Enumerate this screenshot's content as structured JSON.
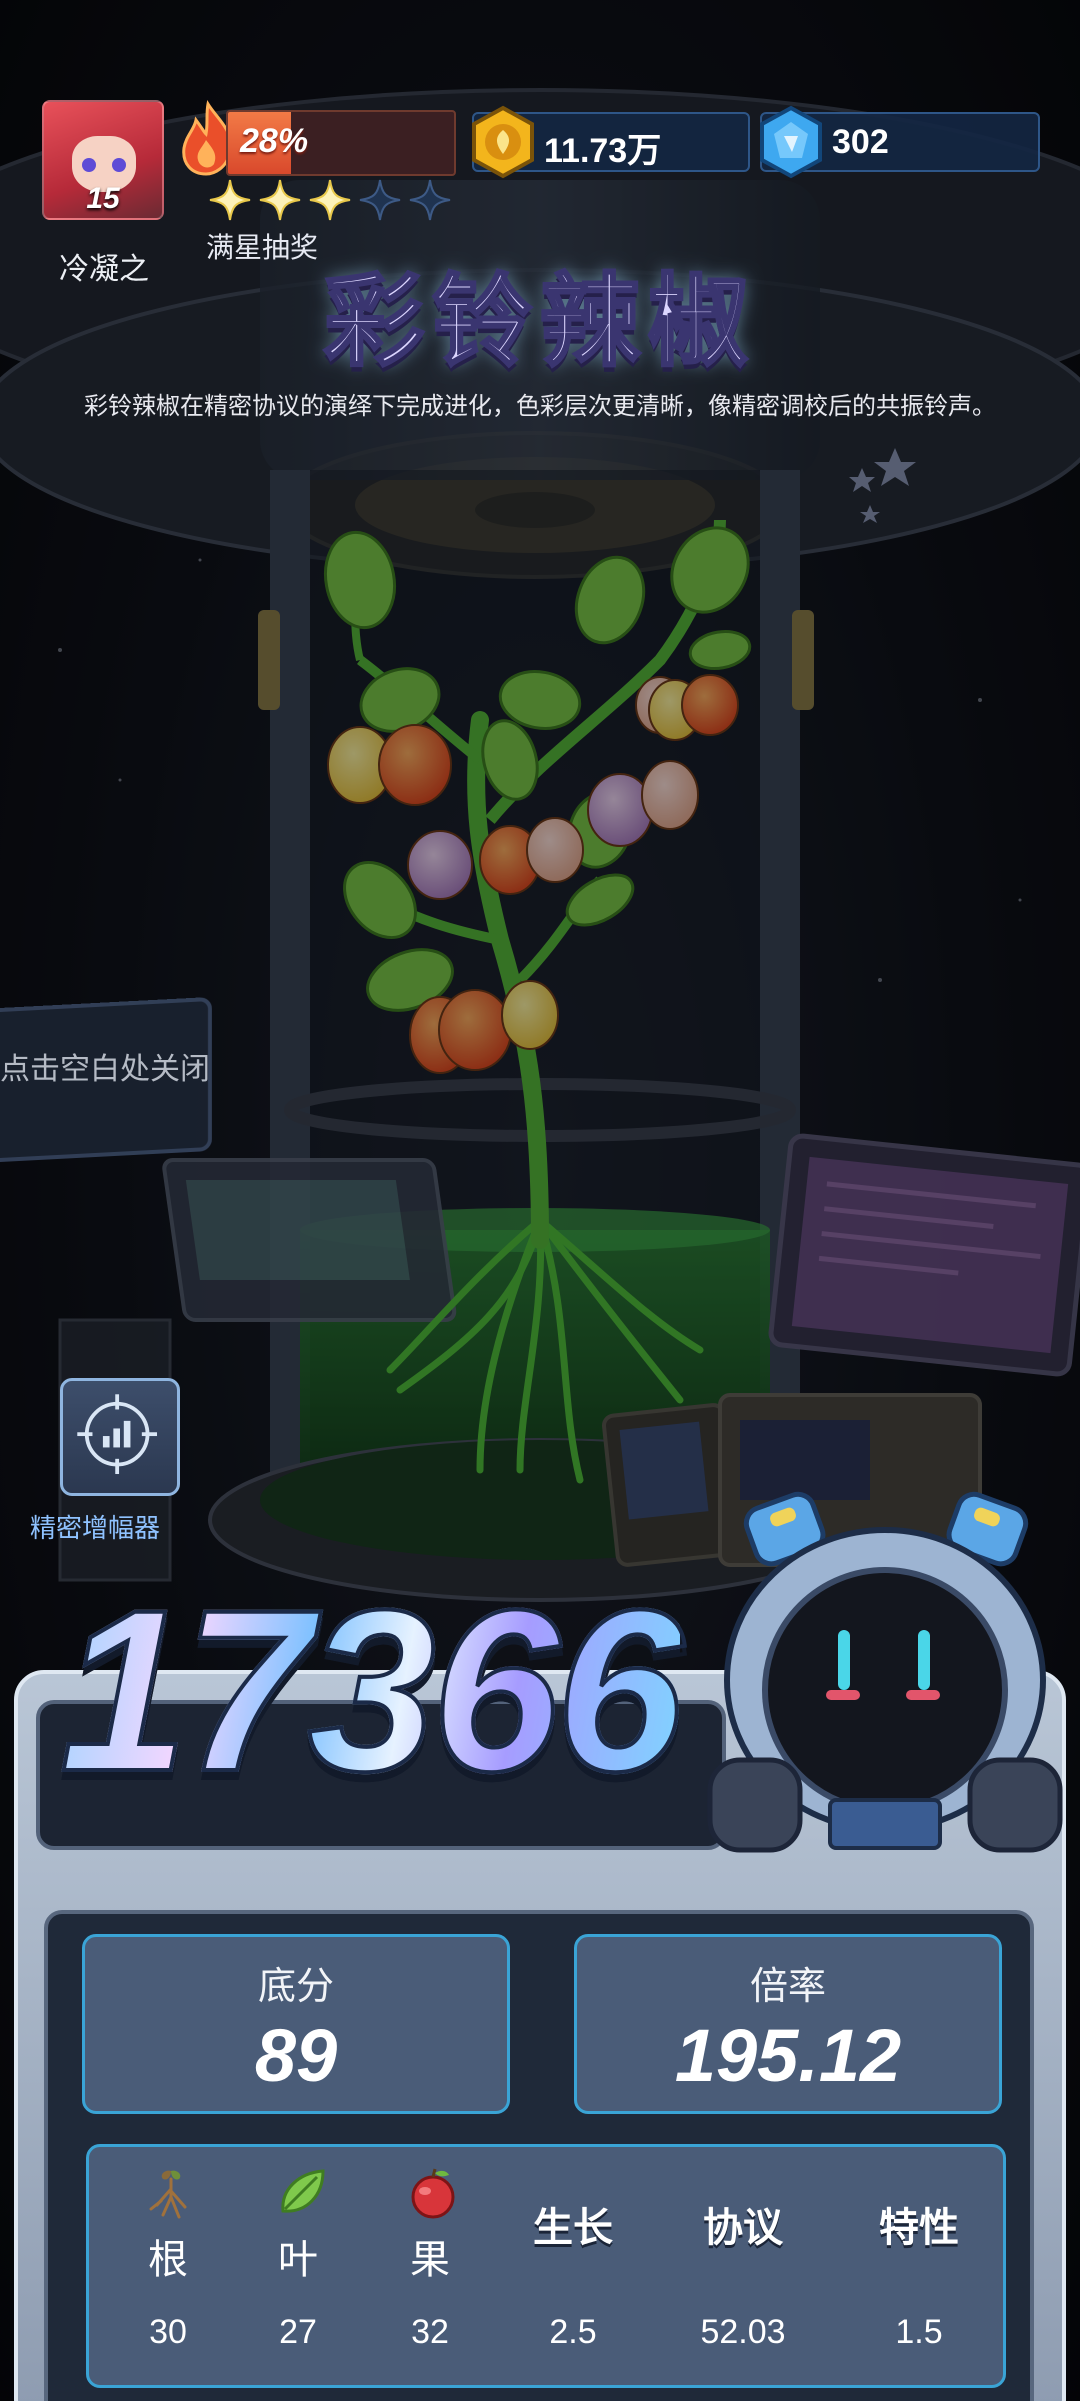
{
  "player": {
    "name": "冷凝之",
    "level": "15"
  },
  "hud": {
    "progress_text": "28%",
    "progress_fraction": 0.28,
    "stars_filled": 3,
    "stars_total": 5,
    "full_star_draw_label": "满星抽奖",
    "gold_value": "11.73万",
    "gem_value": "302"
  },
  "plant": {
    "title": "彩铃辣椒",
    "description": "彩铃辣椒在精密协议的演绎下完成进化，色彩层次更清晰，像精密调校后的共振铃声。"
  },
  "hint": {
    "tap_to_close": "点击空白处关闭"
  },
  "tools": {
    "amplifier_label": "精密增幅器"
  },
  "score": {
    "total": "17366",
    "base_label": "底分",
    "base_value": "89",
    "rate_label": "倍率",
    "rate_value": "195.12"
  },
  "attributes": [
    {
      "name": "根",
      "value": "30",
      "icon": "root-icon"
    },
    {
      "name": "叶",
      "value": "27",
      "icon": "leaf-icon"
    },
    {
      "name": "果",
      "value": "32",
      "icon": "fruit-icon"
    },
    {
      "name": "生长",
      "value": "2.5"
    },
    {
      "name": "协议",
      "value": "52.03"
    },
    {
      "name": "特性",
      "value": "1.5"
    }
  ],
  "colors": {
    "accent_blue": "#3aa4d6",
    "progress_orange": "#e0552f",
    "gold": "#f2b21c",
    "gem_blue": "#3fa8f0"
  }
}
